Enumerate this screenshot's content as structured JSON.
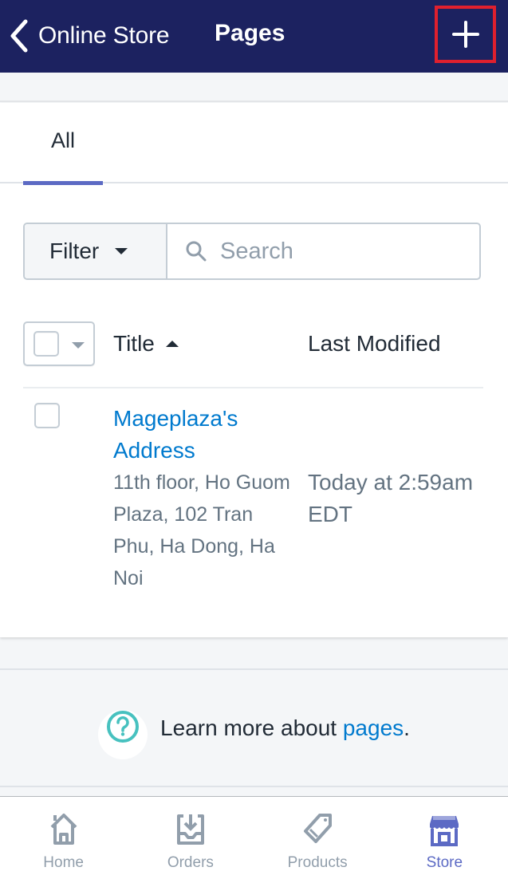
{
  "header": {
    "back_label": "Online Store",
    "title": "Pages",
    "add_icon": "plus-icon",
    "back_icon": "chevron-left-icon",
    "highlight_color": "#e0202e",
    "background_color": "#1c2260"
  },
  "tabs": [
    {
      "label": "All",
      "active": true
    }
  ],
  "filter": {
    "button_label": "Filter",
    "search_placeholder": "Search",
    "search_value": ""
  },
  "table": {
    "columns": [
      {
        "label": "Title",
        "sort": "ascending"
      },
      {
        "label": "Last Modified"
      }
    ],
    "rows": [
      {
        "title": "Mageplaza's Address",
        "description": "11th floor, Ho Guom Plaza, 102 Tran Phu, Ha Dong, Ha Noi",
        "last_modified": "Today at 2:59am EDT",
        "checked": false
      }
    ]
  },
  "help": {
    "text": "Learn more about ",
    "link": "pages",
    "suffix": ".",
    "icon": "question-circle-icon"
  },
  "bottom_nav": {
    "items": [
      {
        "label": "Home",
        "icon": "home-icon",
        "active": false
      },
      {
        "label": "Orders",
        "icon": "orders-inbox-icon",
        "active": false
      },
      {
        "label": "Products",
        "icon": "tag-icon",
        "active": false
      },
      {
        "label": "Store",
        "icon": "store-icon",
        "active": true
      }
    ]
  },
  "colors": {
    "accent": "#5c6ac4",
    "link": "#007ace",
    "muted": "#919eab",
    "help_icon": "#47c1bf"
  }
}
